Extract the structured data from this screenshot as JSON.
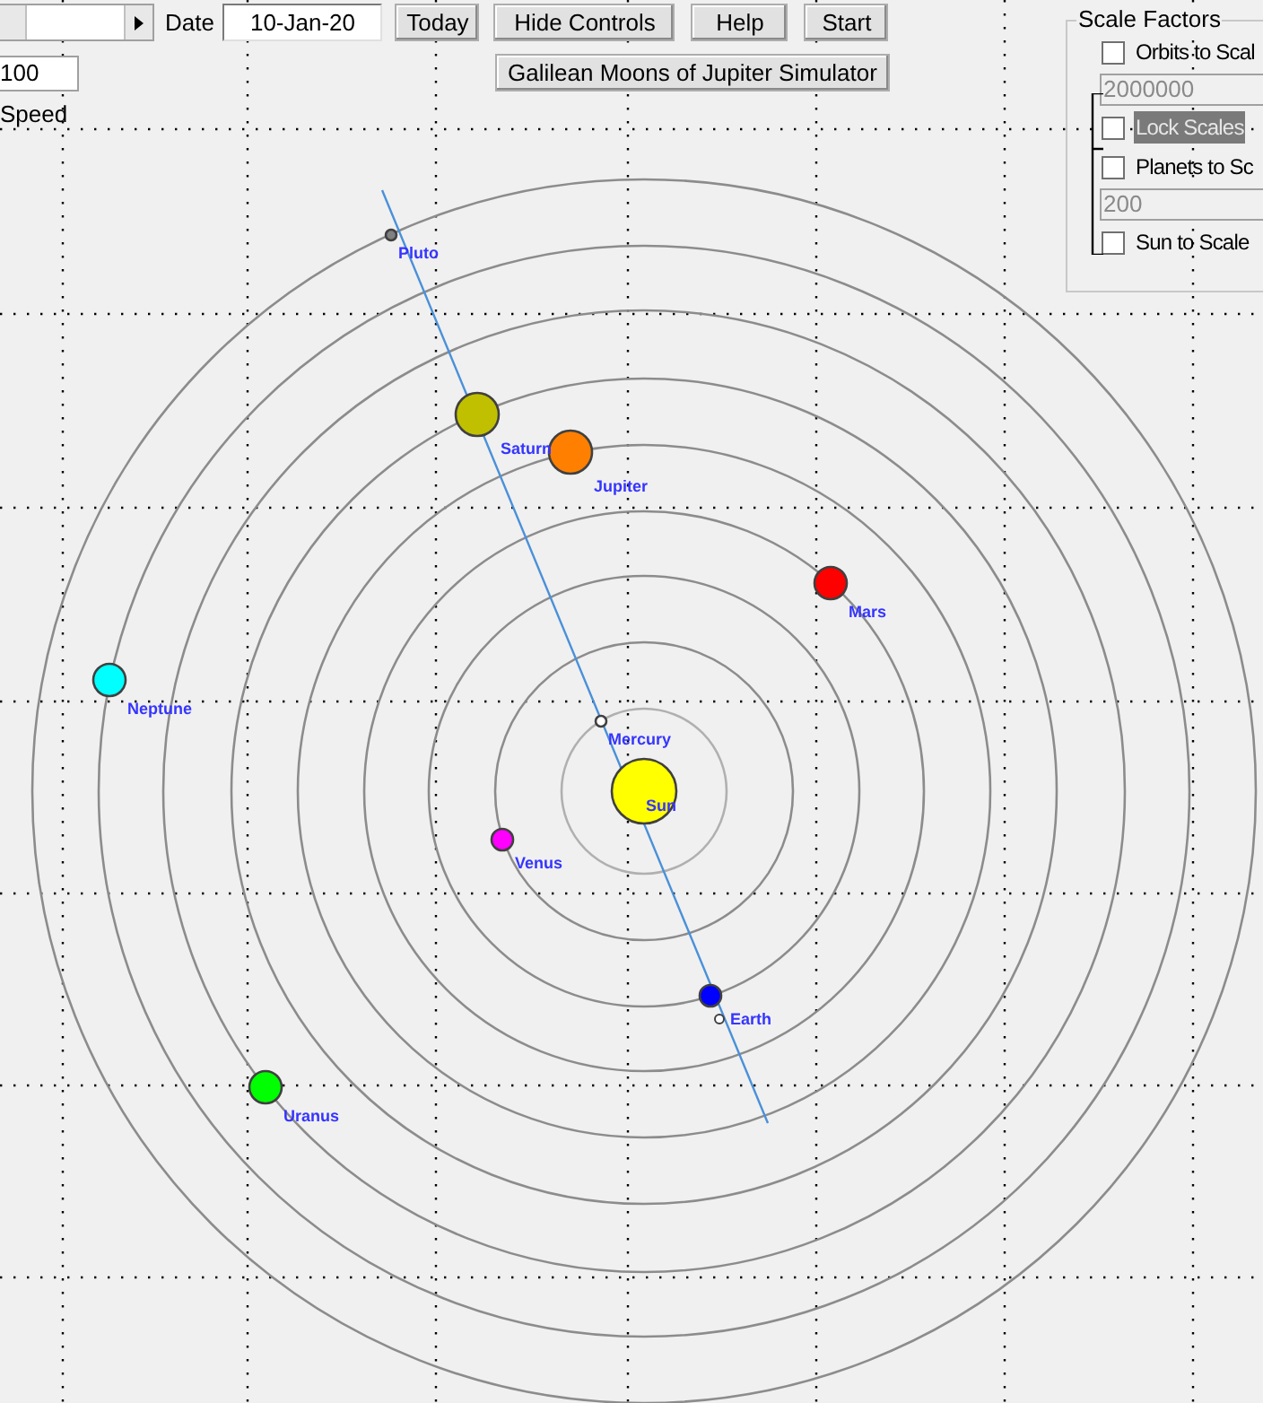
{
  "toolbar": {
    "date_label": "Date",
    "date_field": {
      "value": "10-Jan-20"
    },
    "buttons": [
      "Today",
      "Hide Controls",
      "Help",
      "Start"
    ],
    "simulator_button": "Galilean Moons of Jupiter Simulator"
  },
  "speed": {
    "value": "100",
    "label": "Speed"
  },
  "scale_factors": {
    "title": "Scale Factors",
    "items": [
      {
        "kind": "checkbox",
        "label": "Orbits to Scal",
        "checked": false,
        "highlighted": false
      },
      {
        "kind": "field",
        "value": "2000000",
        "disabled": true
      },
      {
        "kind": "checkbox",
        "label": "Lock Scales",
        "checked": false,
        "highlighted": true
      },
      {
        "kind": "checkbox",
        "label": "Planets to Sc",
        "checked": false,
        "highlighted": false
      },
      {
        "kind": "field",
        "value": "200",
        "disabled": true
      },
      {
        "kind": "checkbox",
        "label": "Sun to Scale",
        "checked": false,
        "highlighted": false
      }
    ]
  },
  "sun": {
    "label": "Sun",
    "color": "#ffff00"
  },
  "planets": [
    {
      "label": "Mercury",
      "color": "#ffffff"
    },
    {
      "label": "Venus",
      "color": "#ff00ff"
    },
    {
      "label": "Earth",
      "color": "#0000ff"
    },
    {
      "label": "Mars",
      "color": "#ff0000"
    },
    {
      "label": "Jupiter",
      "color": "#ff8000"
    },
    {
      "label": "Saturn",
      "color": "#c0c000"
    },
    {
      "label": "Uranus",
      "color": "#00ff00"
    },
    {
      "label": "Neptune",
      "color": "#00ffff"
    },
    {
      "label": "Pluto",
      "color": "#808080"
    }
  ]
}
